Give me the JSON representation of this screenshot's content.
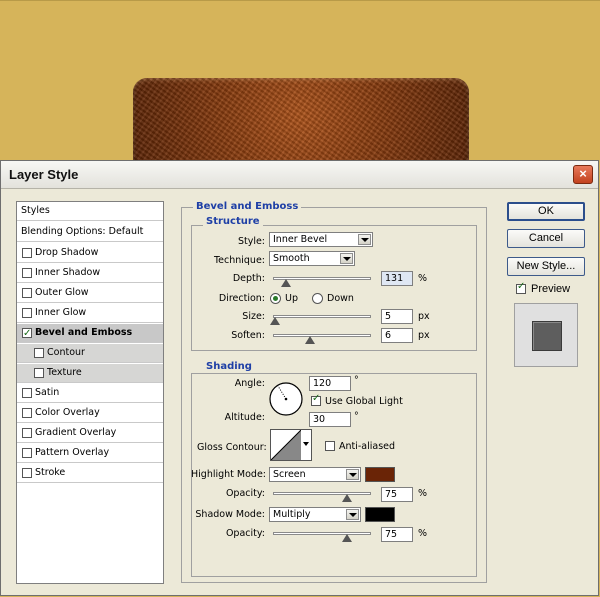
{
  "dialog": {
    "title": "Layer Style",
    "close_symbol": "×"
  },
  "styles_list": [
    {
      "label": "Styles",
      "kind": "header"
    },
    {
      "label": "Blending Options: Default",
      "kind": "header"
    },
    {
      "label": "Drop Shadow",
      "checked": false
    },
    {
      "label": "Inner Shadow",
      "checked": false
    },
    {
      "label": "Outer Glow",
      "checked": false
    },
    {
      "label": "Inner Glow",
      "checked": false
    },
    {
      "label": "Bevel and Emboss",
      "checked": true,
      "selected": true
    },
    {
      "label": "Contour",
      "checked": false,
      "sub": true
    },
    {
      "label": "Texture",
      "checked": false,
      "sub": true
    },
    {
      "label": "Satin",
      "checked": false
    },
    {
      "label": "Color Overlay",
      "checked": false
    },
    {
      "label": "Gradient Overlay",
      "checked": false
    },
    {
      "label": "Pattern Overlay",
      "checked": false
    },
    {
      "label": "Stroke",
      "checked": false
    }
  ],
  "bevel": {
    "section_title": "Bevel and Emboss",
    "structure_title": "Structure",
    "style_label": "Style:",
    "style_value": "Inner Bevel",
    "technique_label": "Technique:",
    "technique_value": "Smooth",
    "depth_label": "Depth:",
    "depth_value": "131",
    "depth_unit": "%",
    "depth_level": 0.13,
    "direction_label": "Direction:",
    "direction_up": "Up",
    "direction_down": "Down",
    "direction_selected": "Up",
    "size_label": "Size:",
    "size_value": "5",
    "size_unit": "px",
    "size_level": 0.02,
    "soften_label": "Soften:",
    "soften_value": "6",
    "soften_unit": "px",
    "soften_level": 0.375
  },
  "shading": {
    "section_title": "Shading",
    "angle_label": "Angle:",
    "angle_value": "120",
    "angle_unit": "°",
    "use_global_light_label": "Use Global Light",
    "use_global_light_checked": true,
    "altitude_label": "Altitude:",
    "altitude_value": "30",
    "altitude_unit": "°",
    "gloss_contour_label": "Gloss Contour:",
    "anti_aliased_label": "Anti-aliased",
    "anti_aliased_checked": false,
    "highlight_mode_label": "Highlight Mode:",
    "highlight_mode_value": "Screen",
    "highlight_color": "#6a2406",
    "highlight_opacity_label": "Opacity:",
    "highlight_opacity_value": "75",
    "highlight_opacity_unit": "%",
    "highlight_opacity_level": 0.75,
    "shadow_mode_label": "Shadow Mode:",
    "shadow_mode_value": "Multiply",
    "shadow_color": "#000000",
    "shadow_opacity_label": "Opacity:",
    "shadow_opacity_value": "75",
    "shadow_opacity_unit": "%",
    "shadow_opacity_level": 0.75
  },
  "buttons": {
    "ok": "OK",
    "cancel": "Cancel",
    "new_style": "New Style...",
    "preview_label": "Preview",
    "preview_checked": true
  },
  "colors": {
    "canvas": "#d6b45a",
    "dialog": "#ece9d8",
    "group_title": "#1e3fa6"
  }
}
